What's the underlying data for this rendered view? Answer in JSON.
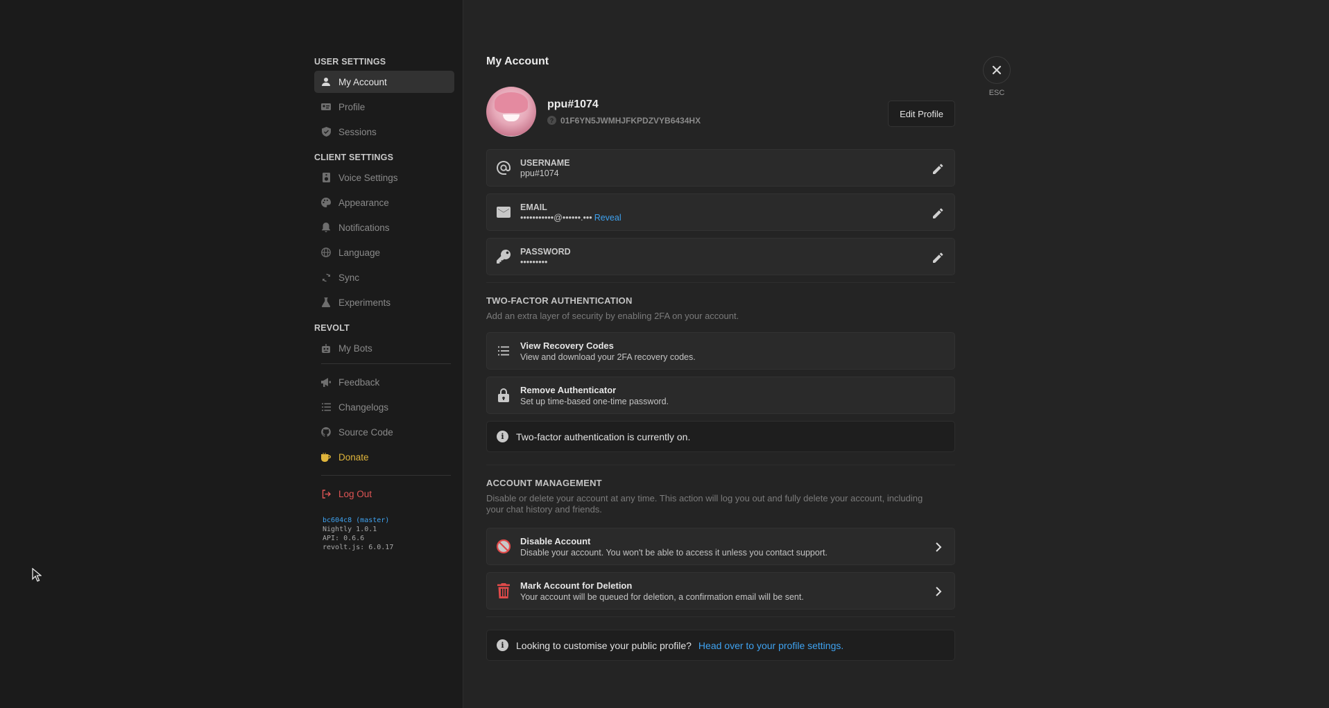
{
  "sidebar": {
    "user_settings_title": "User Settings",
    "user_items": [
      {
        "label": "My Account",
        "icon": "user-icon"
      },
      {
        "label": "Profile",
        "icon": "id-card-icon"
      },
      {
        "label": "Sessions",
        "icon": "shield-icon"
      }
    ],
    "client_settings_title": "Client Settings",
    "client_items": [
      {
        "label": "Voice Settings",
        "icon": "speaker-icon"
      },
      {
        "label": "Appearance",
        "icon": "palette-icon"
      },
      {
        "label": "Notifications",
        "icon": "bell-icon"
      },
      {
        "label": "Language",
        "icon": "globe-icon"
      },
      {
        "label": "Sync",
        "icon": "sync-icon"
      },
      {
        "label": "Experiments",
        "icon": "flask-icon"
      }
    ],
    "revolt_title": "Revolt",
    "revolt_items": [
      {
        "label": "My Bots",
        "icon": "robot-icon"
      }
    ],
    "extra_items": [
      {
        "label": "Feedback",
        "icon": "megaphone-icon"
      },
      {
        "label": "Changelogs",
        "icon": "list-icon"
      },
      {
        "label": "Source Code",
        "icon": "github-icon"
      },
      {
        "label": "Donate",
        "icon": "coffee-icon"
      }
    ],
    "logout_label": "Log Out",
    "version": {
      "commit": "bc604c8 (master)",
      "nightly": "Nightly 1.0.1",
      "api": "API: 0.6.6",
      "revoltjs": "revolt.js: 6.0.17"
    }
  },
  "main": {
    "title": "My Account",
    "profile": {
      "name": "ppu#1074",
      "id": "01F6YN5JWMHJFKPDZVYB6434HX",
      "edit_label": "Edit Profile"
    },
    "fields": {
      "username_label": "Username",
      "username_value": "ppu#1074",
      "email_label": "Email",
      "email_value": "•••••••••••@••••••.•••",
      "email_reveal": "Reveal",
      "password_label": "Password",
      "password_value": "•••••••••"
    },
    "two_factor": {
      "title": "Two-Factor Authentication",
      "description": "Add an extra layer of security by enabling 2FA on your account.",
      "recovery_title": "View Recovery Codes",
      "recovery_desc": "View and download your 2FA recovery codes.",
      "remove_title": "Remove Authenticator",
      "remove_desc": "Set up time-based one-time password.",
      "status": "Two-factor authentication is currently on."
    },
    "account_management": {
      "title": "Account Management",
      "description": "Disable or delete your account at any time. This action will log you out and fully delete your account, including your chat history and friends.",
      "disable_title": "Disable Account",
      "disable_desc": "Disable your account. You won't be able to access it unless you contact support.",
      "delete_title": "Mark Account for Deletion",
      "delete_desc": "Your account will be queued for deletion, a confirmation email will be sent."
    },
    "footer": {
      "text": "Looking to customise your public profile?",
      "link": "Head over to your profile settings."
    }
  },
  "close": {
    "esc_label": "ESC"
  },
  "colors": {
    "accent": "#3fa3f1",
    "donate": "#e0b53b",
    "danger": "#e05555"
  }
}
